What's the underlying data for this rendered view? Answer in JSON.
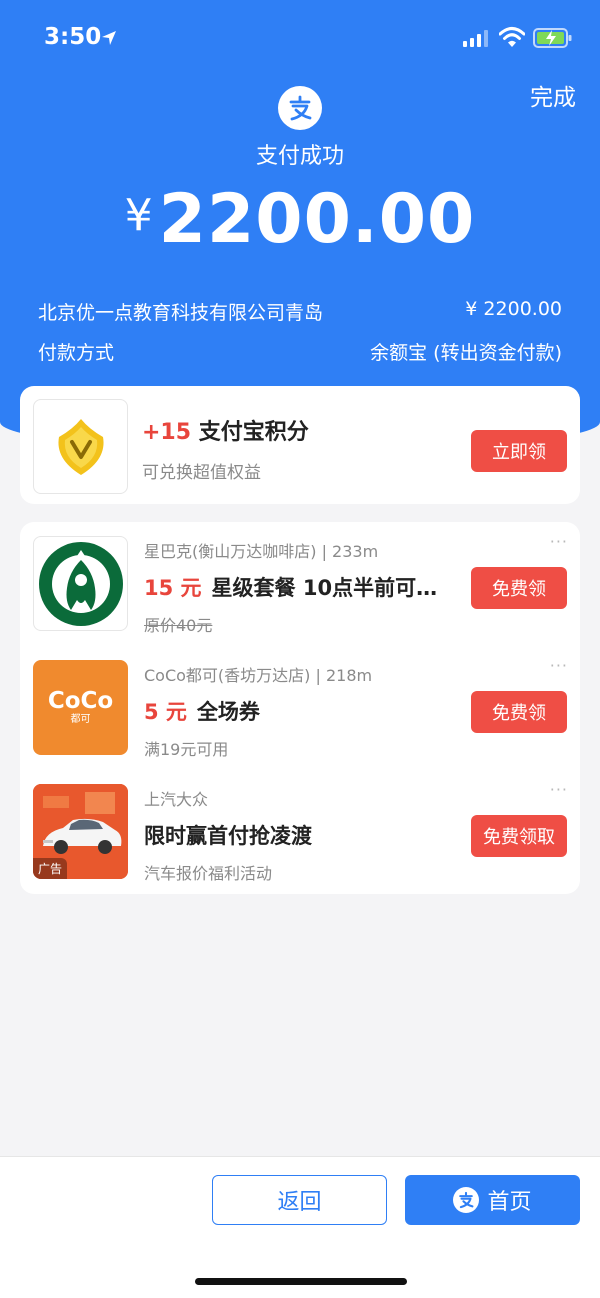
{
  "status_bar": {
    "time": "3:50"
  },
  "header": {
    "done_label": "完成",
    "success_title": "支付成功",
    "currency_symbol": "¥",
    "amount": "2200.00"
  },
  "payment_info": {
    "merchant": "北京优一点教育科技有限公司青岛",
    "merchant_amount": "¥ 2200.00",
    "method_label": "付款方式",
    "method_value": "余额宝 (转出资金付款)"
  },
  "points_card": {
    "points_value": "+15",
    "points_label": "支付宝积分",
    "subtitle": "可兑换超值权益",
    "button_label": "立即领"
  },
  "coupons": [
    {
      "meta": "星巴克(衡山万达咖啡店) | 233m",
      "price": "15 元",
      "title": "星级套餐 10点半前可…",
      "sub": "原价40元",
      "button_label": "免费领"
    },
    {
      "meta": "CoCo都可(香坊万达店) | 218m",
      "price": "5 元",
      "title": "全场券",
      "sub": "满19元可用",
      "button_label": "免费领",
      "logo_text": "CoCo",
      "logo_sub": "都可"
    },
    {
      "meta": "上汽大众",
      "title": "限时赢首付抢凌渡",
      "sub": "汽车报价福利活动",
      "button_label": "免费领取",
      "ad_label": "广告"
    }
  ],
  "more_icon": "···",
  "bottom": {
    "back_label": "返回",
    "home_label": "首页"
  },
  "colors": {
    "brand_blue": "#2f7ff5",
    "accent_red": "#ef4e45"
  }
}
